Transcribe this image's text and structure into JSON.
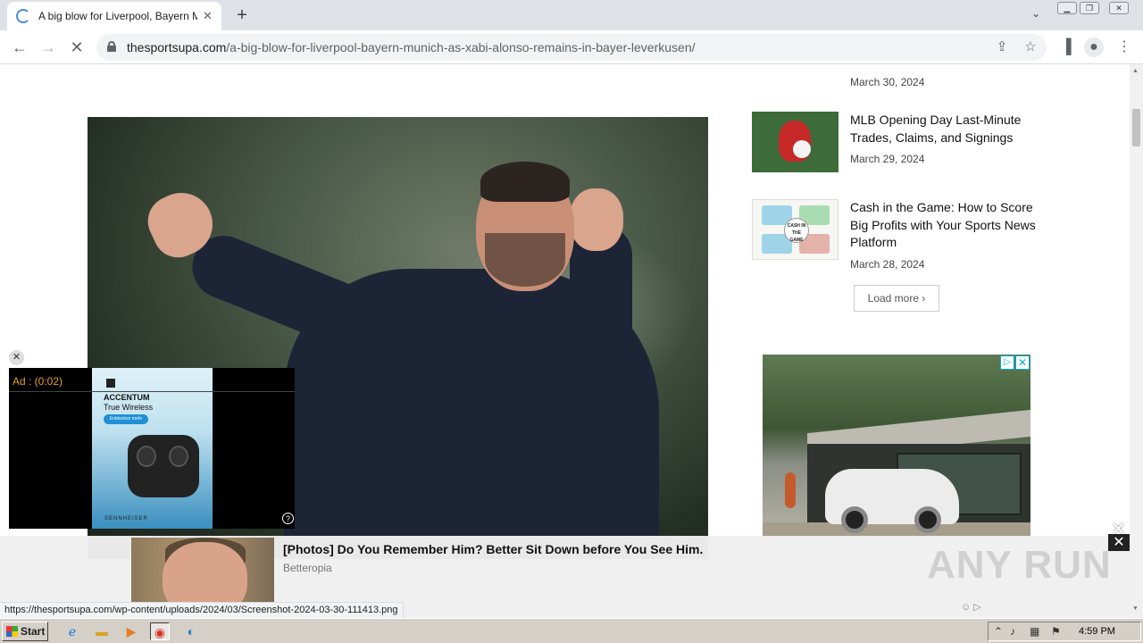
{
  "browser": {
    "tab": {
      "title": "A big blow for Liverpool, Bayern Munich as Xabi Alonso remains in Bayer Leverkusen"
    },
    "url": {
      "host": "thesportsupa.com",
      "path": "/a-big-blow-for-liverpool-bayern-munich-as-xabi-alonso-remains-in-bayer-leverkusen/"
    },
    "status_url": "https://thesportsupa.com/wp-content/uploads/2024/03/Screenshot-2024-03-30-111413.png"
  },
  "sidebar": {
    "top_date": "March 30, 2024",
    "posts": [
      {
        "title": "MLB Opening Day Last-Minute Trades, Claims, and Signings",
        "date": "March 29, 2024"
      },
      {
        "title": "Cash in the Game: How to Score Big Profits with Your Sports News Platform",
        "date": "March 28, 2024"
      }
    ],
    "load_more": "Load more",
    "cash_thumb_center": "CASH IN THE GAME"
  },
  "video_ad": {
    "timer": "Ad : (0:02)",
    "product_title": "ACCENTUM",
    "product_sub": "True Wireless",
    "pill": "Entdecken mehr",
    "brand": "SENNHEISER"
  },
  "bottom_ad": {
    "title": "[Photos] Do You Remember Him? Better Sit Down before You See Him.",
    "source": "Betteropia"
  },
  "watermark": "ANY RUN",
  "taskbar": {
    "start": "Start",
    "clock": "4:59 PM"
  },
  "colors": {
    "accent": "#1a73e8",
    "adchoices": "#00aecd",
    "ad_timer": "#e0a020"
  },
  "icons": [
    "back-icon",
    "forward-icon",
    "stop-icon",
    "lock-icon",
    "share-icon",
    "star-icon",
    "sidepanel-icon",
    "profile-icon",
    "menu-icon"
  ]
}
